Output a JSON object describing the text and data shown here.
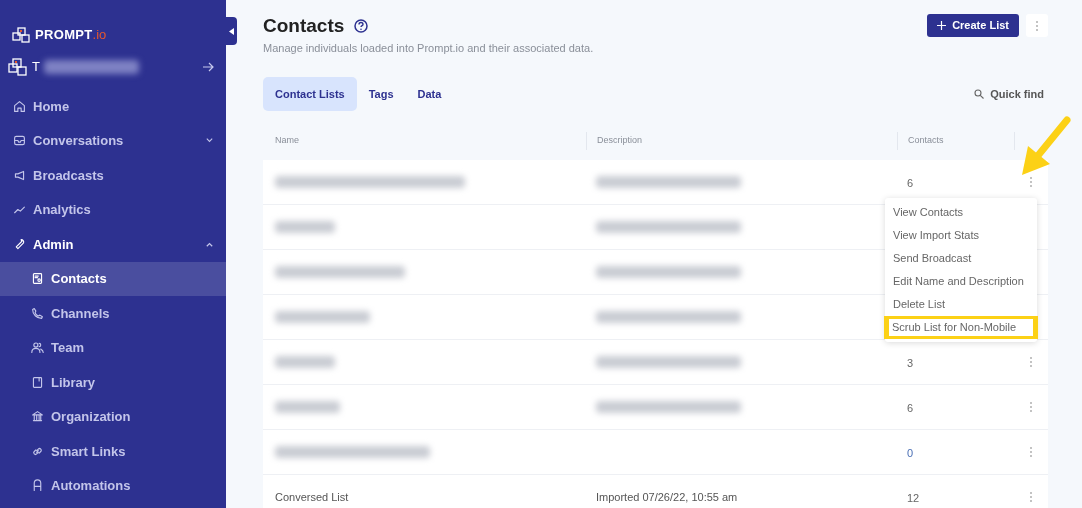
{
  "sidebar": {
    "logo": {
      "word": "PROMPT",
      "suffix": ".io"
    },
    "workspace": {
      "name_start": "T",
      "blurred": true
    },
    "items": [
      {
        "label": "Home",
        "selected": false
      },
      {
        "label": "Conversations",
        "selected": false,
        "expanded": false
      },
      {
        "label": "Broadcasts",
        "selected": false
      },
      {
        "label": "Analytics",
        "selected": false
      },
      {
        "label": "Admin",
        "selected": false,
        "expanded": true,
        "children": [
          {
            "label": "Contacts",
            "selected": true
          },
          {
            "label": "Channels",
            "selected": false
          },
          {
            "label": "Team",
            "selected": false
          },
          {
            "label": "Library",
            "selected": false
          },
          {
            "label": "Organization",
            "selected": false
          },
          {
            "label": "Smart Links",
            "selected": false
          },
          {
            "label": "Automations",
            "selected": false
          }
        ]
      }
    ]
  },
  "page": {
    "title": "Contacts",
    "subtitle": "Manage individuals loaded into Prompt.io and their associated data.",
    "create_button": "Create List"
  },
  "tabs": [
    {
      "label": "Contact Lists",
      "selected": true
    },
    {
      "label": "Tags",
      "selected": false
    },
    {
      "label": "Data",
      "selected": false
    }
  ],
  "quick_find": "Quick find",
  "table": {
    "columns": [
      "Name",
      "Description",
      "Contacts"
    ],
    "rows": [
      {
        "blurred": true,
        "has_description": true,
        "contacts": "6",
        "menu_button": true,
        "menu_open": true
      },
      {
        "blurred": true,
        "has_description": true,
        "menu_button": false,
        "menu_open": false
      },
      {
        "blurred": true,
        "has_description": true,
        "menu_button": false,
        "menu_open": false
      },
      {
        "blurred": true,
        "has_description": true,
        "menu_button": false,
        "menu_open": false
      },
      {
        "blurred": true,
        "has_description": true,
        "contacts": "3",
        "menu_button": true,
        "menu_open": false
      },
      {
        "blurred": true,
        "has_description": true,
        "contacts": "6",
        "menu_button": true,
        "menu_open": false
      },
      {
        "blurred": true,
        "has_description": false,
        "contacts": "0",
        "menu_button": true,
        "menu_open": false
      },
      {
        "blurred": false,
        "name": "Conversed List",
        "description": "Imported 07/26/22, 10:55 am",
        "contacts": "12",
        "menu_button": true,
        "menu_open": false
      }
    ]
  },
  "row_menu": {
    "items": [
      {
        "label": "View Contacts",
        "highlighted": false
      },
      {
        "label": "View Import Stats",
        "highlighted": false
      },
      {
        "label": "Send Broadcast",
        "highlighted": false
      },
      {
        "label": "Edit Name and Description",
        "highlighted": false
      },
      {
        "label": "Delete List",
        "highlighted": false
      },
      {
        "label": "Scrub List for Non-Mobile",
        "highlighted": true
      }
    ]
  },
  "annotation": {
    "arrow": true
  }
}
